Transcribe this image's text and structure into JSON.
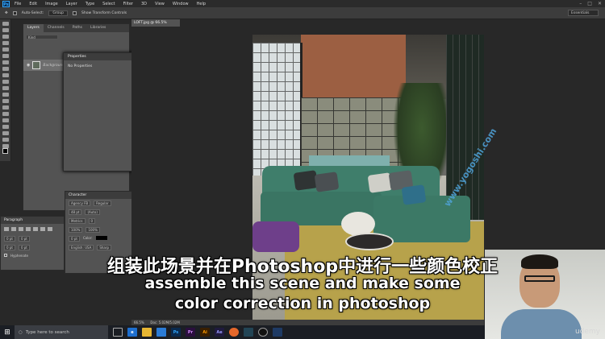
{
  "app": {
    "logo": "Ps",
    "menu": [
      "File",
      "Edit",
      "Image",
      "Layer",
      "Type",
      "Select",
      "Filter",
      "3D",
      "View",
      "Window",
      "Help"
    ],
    "window_controls": [
      "–",
      "□",
      "✕"
    ]
  },
  "options_bar": {
    "auto_select_label": "Auto-Select:",
    "auto_select_value": "Group",
    "transform_label": "Show Transform Controls",
    "workspace": "Essentials"
  },
  "layers_panel": {
    "tabs": [
      "Layers",
      "Channels",
      "Paths",
      "Libraries"
    ],
    "search_placeholder": "Kind",
    "layer_name": "Background"
  },
  "properties_panel": {
    "title": "Properties",
    "body": "No Properties"
  },
  "character_panel": {
    "title": "Character",
    "font": "Agency FB",
    "style": "Regular",
    "size": "48 pt",
    "leading": "(Auto)",
    "kerning": "Metrics",
    "tracking": "0",
    "scale_v": "100%",
    "scale_h": "100%",
    "baseline": "0 pt",
    "color_label": "Color:",
    "language": "English: USA",
    "antialias": "Sharp"
  },
  "paragraph_panel": {
    "title": "Paragraph",
    "indent_left": "0 pt",
    "indent_right": "0 pt",
    "space_before": "0 pt",
    "space_after": "0 pt",
    "hyphenate": "Hyphenate"
  },
  "document": {
    "tab_title": "LOFT.jpg @ 66.5% (RGB/8#)",
    "zoom": "66.5%",
    "doc_size": "Doc: 5.02M/5.02M"
  },
  "subtitles": {
    "chinese": "组装此场景并在Photoshop中进行一些颜色校正",
    "english_line1": "assemble this scene and make some",
    "english_line2": "color correction in photoshop"
  },
  "watermark": "www.yogoshi.com",
  "webcam": {
    "brand": "udemy"
  },
  "taskbar": {
    "search_placeholder": "Type here to search",
    "icons": [
      "task-view",
      "edge",
      "file-explorer",
      "store",
      "photoshop",
      "premiere",
      "illustrator",
      "after-effects",
      "firefox",
      "camera-raw",
      "unreal",
      "cinema4d"
    ]
  }
}
